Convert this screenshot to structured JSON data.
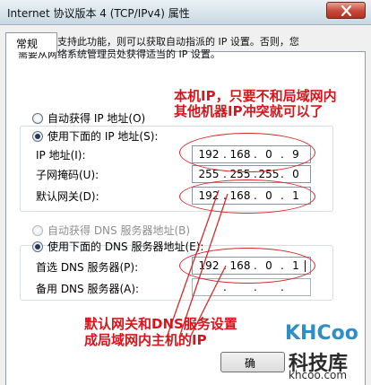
{
  "window": {
    "title": "Internet 协议版本 4 (TCP/IPv4) 属性"
  },
  "tabs": [
    {
      "label": "常规"
    }
  ],
  "description": "如果网络支持此功能，则可以获取自动指派的 IP 设置。否则，您需要从网络系统管理员处获得适当的 IP 设置。",
  "ip_settings": {
    "auto_ip_label": "自动获得 IP 地址(O)",
    "manual_ip_label": "使用下面的 IP 地址(S):",
    "ip_address_label": "IP 地址(I):",
    "subnet_label": "子网掩码(U):",
    "gateway_label": "默认网关(D):",
    "ip_address": [
      "192",
      "168",
      "0",
      "9"
    ],
    "subnet": [
      "255",
      "255",
      "255",
      "0"
    ],
    "gateway": [
      "192",
      "168",
      "0",
      "1"
    ]
  },
  "dns_settings": {
    "auto_dns_label": "自动获得 DNS 服务器地址(B)",
    "manual_dns_label": "使用下面的 DNS 服务器地址(E):",
    "preferred_label": "首选 DNS 服务器(P):",
    "alternate_label": "备用 DNS 服务器(A):",
    "preferred": [
      "192",
      "168",
      "0",
      "1"
    ],
    "alternate": [
      "",
      "",
      "",
      ""
    ]
  },
  "annotations": {
    "ip_note_line1": "本机IP，只要不和局域网内",
    "ip_note_line2": "其他机器IP冲突就可以了",
    "gateway_note_line1": "默认网关和DNS服务设置",
    "gateway_note_line2": "成局域网内主机的IP"
  },
  "buttons": {
    "ok_partial_label": "确"
  },
  "watermark": {
    "logo": "KHCoo",
    "name": "科技库",
    "url": "khcoo.com"
  },
  "colors": {
    "annotation_red": "#d6161c",
    "watermark_blue": "#2f8ec5"
  }
}
